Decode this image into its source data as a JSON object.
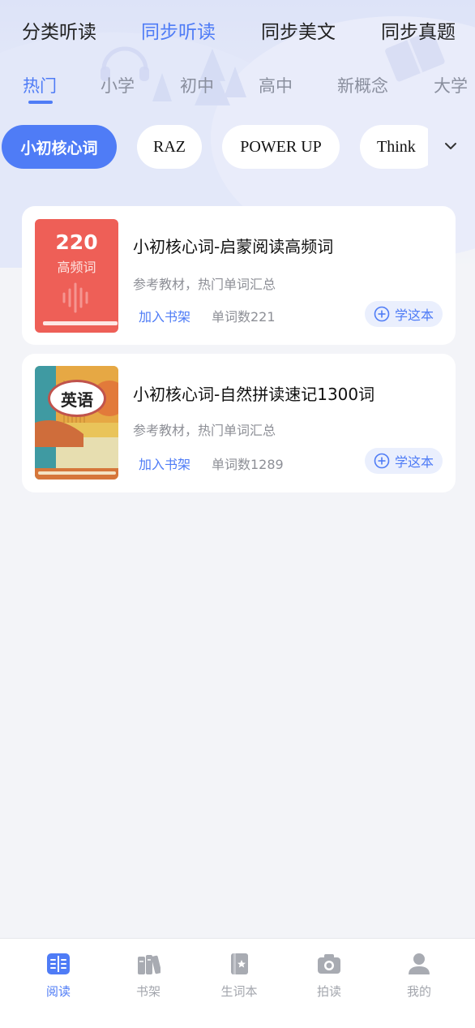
{
  "main_tabs": [
    {
      "label": "分类听读",
      "active": false
    },
    {
      "label": "同步听读",
      "active": true
    },
    {
      "label": "同步美文",
      "active": false
    },
    {
      "label": "同步真题",
      "active": false
    }
  ],
  "level_tabs": [
    {
      "label": "热门",
      "active": true
    },
    {
      "label": "小学",
      "active": false
    },
    {
      "label": "初中",
      "active": false
    },
    {
      "label": "高中",
      "active": false
    },
    {
      "label": "新概念",
      "active": false
    },
    {
      "label": "大学",
      "active": false
    }
  ],
  "series_chips": [
    {
      "label": "小初核心词",
      "active": true
    },
    {
      "label": "RAZ",
      "active": false
    },
    {
      "label": "POWER UP",
      "active": false
    },
    {
      "label": "Think",
      "active": false
    }
  ],
  "books": [
    {
      "title": "小初核心词-启蒙阅读高频词",
      "desc": "参考教材，热门单词汇总",
      "add_label": "加入书架",
      "word_count": "单词数221",
      "study_label": "学这本",
      "cover": {
        "big": "220",
        "small": "高频词"
      }
    },
    {
      "title": "小初核心词-自然拼读速记1300词",
      "desc": "参考教材，热门单词汇总",
      "add_label": "加入书架",
      "word_count": "单词数1289",
      "study_label": "学这本",
      "cover": {
        "badge": "英语"
      }
    }
  ],
  "bottom_nav": [
    {
      "label": "阅读",
      "icon": "book-open-icon",
      "active": true
    },
    {
      "label": "书架",
      "icon": "bookshelf-icon",
      "active": false
    },
    {
      "label": "生词本",
      "icon": "notebook-icon",
      "active": false
    },
    {
      "label": "拍读",
      "icon": "camera-icon",
      "active": false
    },
    {
      "label": "我的",
      "icon": "user-icon",
      "active": false
    }
  ],
  "colors": {
    "accent": "#4f7cf6",
    "cover_red": "#ee5f57",
    "background": "#f3f4f8"
  }
}
